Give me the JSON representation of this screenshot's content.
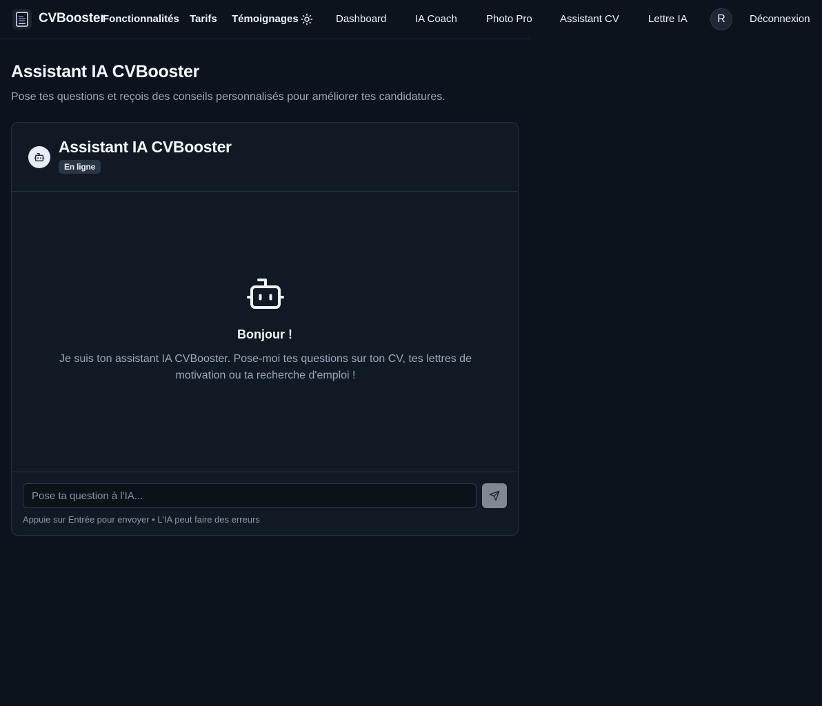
{
  "nav": {
    "brand": "CVBooster",
    "links": [
      "Fonctionnalités",
      "Tarifs",
      "Témoignages"
    ],
    "app_links": [
      "Dashboard",
      "IA Coach",
      "Photo Pro",
      "Assistant CV",
      "Lettre IA"
    ],
    "avatar_initial": "R",
    "logout_label": "Déconnexion",
    "theme_icon": "sun-icon"
  },
  "page": {
    "title": "Assistant IA CVBooster",
    "subtitle": "Pose tes questions et reçois des conseils personnalisés pour améliorer tes candidatures."
  },
  "chat": {
    "title": "Assistant IA CVBooster",
    "status": "En ligne",
    "greeting": "Bonjour !",
    "intro": "Je suis ton assistant IA CVBooster. Pose-moi tes questions sur ton CV, tes lettres de motivation ou ta recherche d'emploi !",
    "input_placeholder": "Pose ta question à l'IA...",
    "input_value": "",
    "hint": "Appuie sur Entrée pour envoyer • L'IA peut faire des erreurs",
    "send_icon": "send-icon",
    "bot_icon": "bot-icon"
  },
  "colors": {
    "background": "#0c131d",
    "card": "#111a24",
    "border": "#27323f",
    "muted_text": "#9aa8bb",
    "send_button": "#7f8893"
  }
}
